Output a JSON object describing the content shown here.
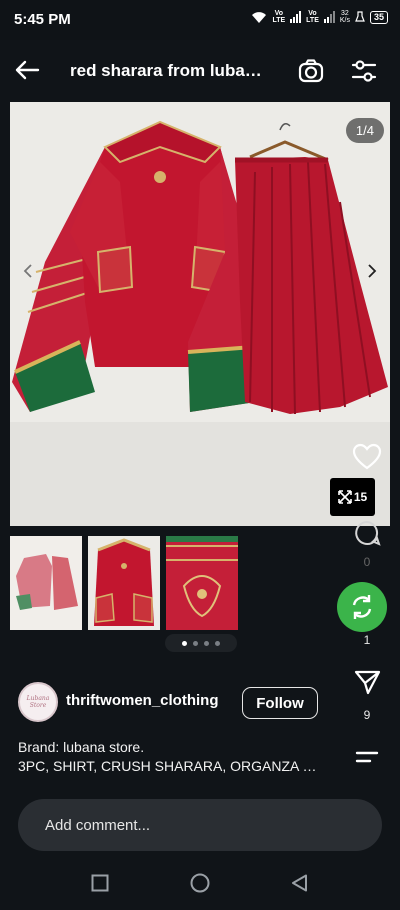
{
  "status_bar": {
    "time": "5:45 PM",
    "net1": "Vo\nLTE",
    "net2": "Vo\nLTE",
    "speed": "32\nK/s",
    "battery": "35"
  },
  "header": {
    "title": "red sharara from luba…"
  },
  "gallery": {
    "counter": "1/4",
    "dots_total": 4,
    "dots_active": 0
  },
  "actions": {
    "zoom_count": "15",
    "comments_count": "0",
    "share_count": "1",
    "send_count": "9"
  },
  "account": {
    "username": "thriftwomen_clothing",
    "follow_label": "Follow",
    "avatar_text": "Lubana Store"
  },
  "description": {
    "line1": "Brand: lubana store.",
    "line2": "3PC, SHIRT, CRUSH SHARARA, ORGANZA …"
  },
  "comment": {
    "placeholder": "Add comment..."
  },
  "colors": {
    "background": "#101418",
    "accent_green": "#3bb44a",
    "garment_red": "#b8172e"
  }
}
